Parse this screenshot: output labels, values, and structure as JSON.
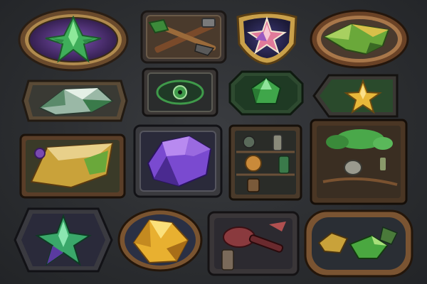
{
  "board": {
    "background_color": "#2b2d30",
    "item_count": 16
  },
  "badges": [
    {
      "icon": "green-leaf-gem-icon",
      "frame": "bronze-oval",
      "gem_color": "#3fae5a",
      "inner_color": "#4a2a6e"
    },
    {
      "icon": "crossed-tools-icon",
      "frame": "stone-rect",
      "gem_color": "#3c8a3a",
      "inner_color": "#4a3a2c"
    },
    {
      "icon": "pink-star-gem-icon",
      "frame": "gold-shield",
      "gem_color": "#e07a9a",
      "inner_color": "#2e2a55"
    },
    {
      "icon": "green-gold-crystal-icon",
      "frame": "bronze-oval",
      "gem_color": "#6aa83a",
      "inner_color": "#4a3a2e"
    },
    {
      "icon": "silver-crystal-shard-icon",
      "frame": "stone-hex",
      "gem_color": "#9ab8a6",
      "inner_color": "#3a3a34"
    },
    {
      "icon": "green-eye-rune-icon",
      "frame": "dark-rect",
      "gem_color": "#3f9a4a",
      "inner_color": "#2a2c2c"
    },
    {
      "icon": "green-gem-icon",
      "frame": "green-octagon",
      "gem_color": "#3fa64a",
      "inner_color": "#1f3a24"
    },
    {
      "icon": "gold-star-icon",
      "frame": "dark-arrow",
      "gem_color": "#e8b83a",
      "inner_color": "#2a4a2c"
    },
    {
      "icon": "parchment-scroll-icon",
      "frame": "wood-rect",
      "gem_color": "#c9a23a",
      "inner_color": "#3a3a28"
    },
    {
      "icon": "purple-ore-icon",
      "frame": "dark-rect",
      "gem_color": "#7a4ad0",
      "inner_color": "#2a2a3a"
    },
    {
      "icon": "potion-shelf-icon",
      "frame": "wood-cabinet",
      "gem_color": "#c98a3a",
      "inner_color": "#2a2c28"
    },
    {
      "icon": "garden-plants-icon",
      "frame": "wood-box",
      "gem_color": "#4aa84a",
      "inner_color": "#3a2e22"
    },
    {
      "icon": "emerald-star-gem-icon",
      "frame": "dark-hex",
      "gem_color": "#3aa86a",
      "inner_color": "#2a2a3a"
    },
    {
      "icon": "gold-crystal-icon",
      "frame": "bronze-oval",
      "gem_color": "#e8b030",
      "inner_color": "#2a3044"
    },
    {
      "icon": "red-key-tools-icon",
      "frame": "dark-rect",
      "gem_color": "#8a3a3e",
      "inner_color": "#2c2a30"
    },
    {
      "icon": "mixed-gems-icon",
      "frame": "bronze-rounded",
      "gem_color": "#4aa840",
      "inner_color": "#2a2e34"
    }
  ]
}
